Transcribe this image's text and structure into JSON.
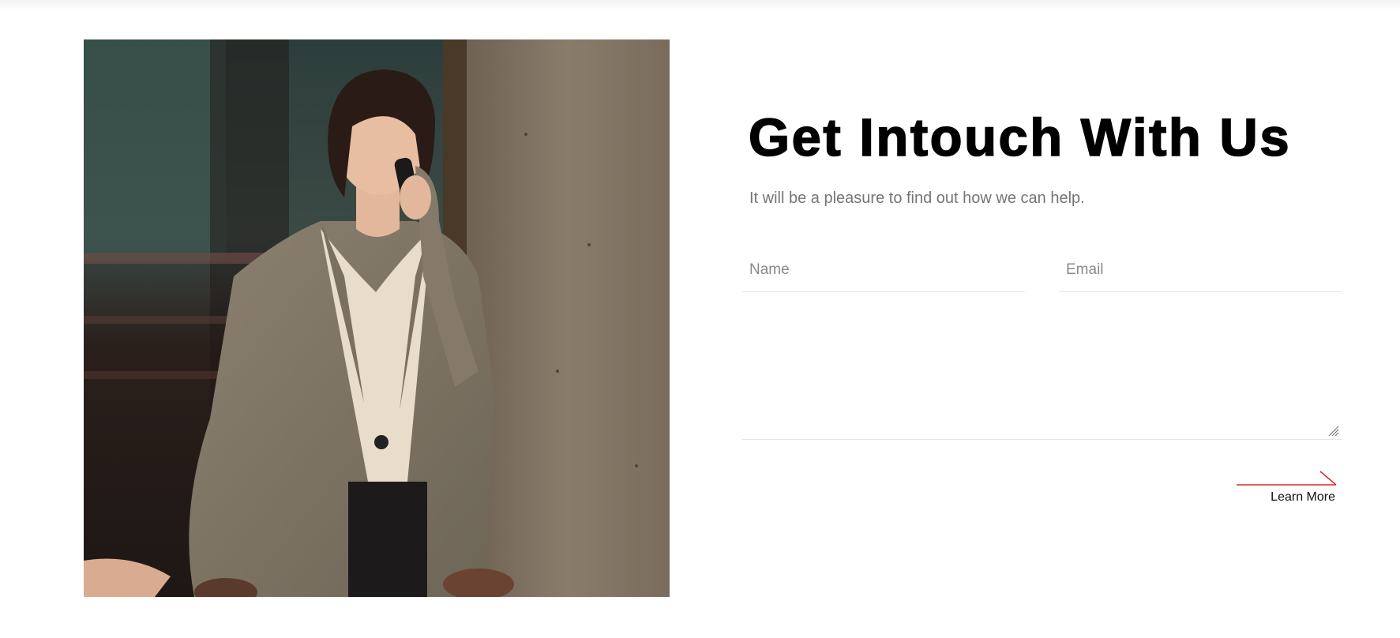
{
  "contact": {
    "heading": "Get Intouch With Us",
    "subtext": "It will be a pleasure to find out how we can help.",
    "name_placeholder": "Name",
    "email_placeholder": "Email",
    "message_placeholder": "",
    "submit_label": "Learn More"
  },
  "icons": {
    "submit_arrow": "arrow-right-icon",
    "resize": "resize-grip-icon"
  },
  "colors": {
    "accent": "#d62b2b",
    "heading": "#000000",
    "subtext": "#757575",
    "field_border": "#e6e6e6"
  }
}
